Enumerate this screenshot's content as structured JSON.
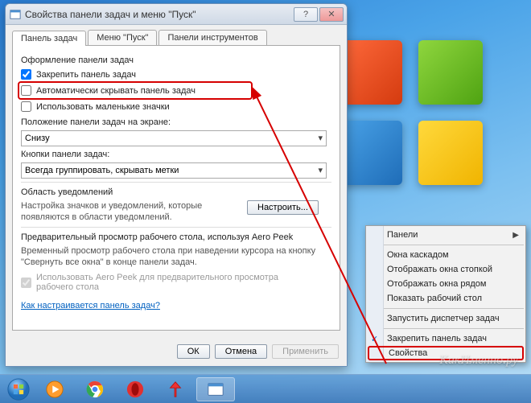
{
  "dialog": {
    "title": "Свойства панели задач и меню \"Пуск\"",
    "tabs": [
      "Панель задач",
      "Меню \"Пуск\"",
      "Панели инструментов"
    ],
    "active_tab": 0,
    "group1_label": "Оформление панели задач",
    "checkboxes": {
      "lock": {
        "label": "Закрепить панель задач",
        "checked": true
      },
      "autohide": {
        "label": "Автоматически скрывать панель задач",
        "checked": false
      },
      "smallicons": {
        "label": "Использовать маленькие значки",
        "checked": false
      }
    },
    "position_label": "Положение панели задач на экране:",
    "position_value": "Снизу",
    "buttons_label": "Кнопки панели задач:",
    "buttons_value": "Всегда группировать, скрывать метки",
    "notif": {
      "title": "Область уведомлений",
      "desc": "Настройка значков и уведомлений, которые появляются в области уведомлений.",
      "btn": "Настроить..."
    },
    "aero": {
      "title": "Предварительный просмотр рабочего стола, используя Aero Peek",
      "desc": "Временный просмотр рабочего стола при наведении курсора на кнопку \"Свернуть все окна\" в конце панели задач.",
      "checkbox": {
        "label": "Использовать Aero Peek для предварительного просмотра рабочего стола",
        "checked": true
      }
    },
    "help_link": "Как настраивается панель задач?",
    "buttons": {
      "ok": "ОК",
      "cancel": "Отмена",
      "apply": "Применить"
    }
  },
  "context_menu": {
    "items": [
      {
        "label": "Панели",
        "arrow": true
      },
      {
        "sep": true
      },
      {
        "label": "Окна каскадом"
      },
      {
        "label": "Отображать окна стопкой"
      },
      {
        "label": "Отображать окна рядом"
      },
      {
        "label": "Показать рабочий стол"
      },
      {
        "sep": true
      },
      {
        "label": "Запустить диспетчер задач"
      },
      {
        "sep": true
      },
      {
        "label": "Закрепить панель задач",
        "checked": true
      },
      {
        "label": "Свойства",
        "highlighted": true
      }
    ]
  },
  "watermark": "КакИменно.ру",
  "taskbar_apps": [
    "start",
    "media-player",
    "chrome",
    "opera",
    "yandex",
    "explorer"
  ]
}
